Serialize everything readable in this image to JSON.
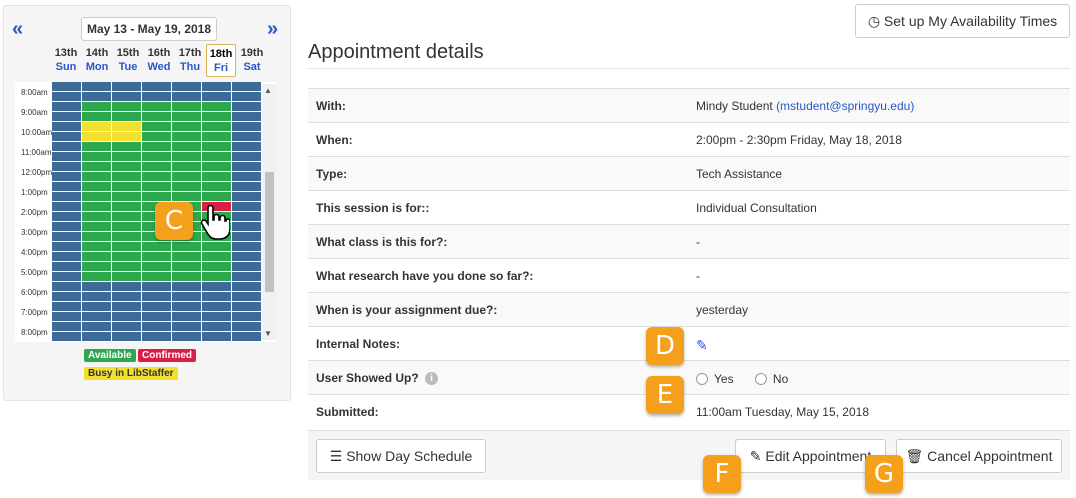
{
  "calendar": {
    "prev_icon": "«",
    "next_icon": "»",
    "week_range": "May 13 - May 19, 2018",
    "days": [
      {
        "num": "13th",
        "name": "Sun"
      },
      {
        "num": "14th",
        "name": "Mon"
      },
      {
        "num": "15th",
        "name": "Tue"
      },
      {
        "num": "16th",
        "name": "Wed"
      },
      {
        "num": "17th",
        "name": "Thu"
      },
      {
        "num": "18th",
        "name": "Fri"
      },
      {
        "num": "19th",
        "name": "Sat"
      }
    ],
    "selected_day_index": 5,
    "time_labels": [
      "8:00am",
      "9:00am",
      "10:00am",
      "11:00am",
      "12:00pm",
      "1:00pm",
      "2:00pm",
      "3:00pm",
      "4:00pm",
      "5:00pm",
      "6:00pm",
      "7:00pm",
      "8:00pm"
    ],
    "colors": {
      "unavailable": "#3d6a96",
      "available": "#2da84f",
      "confirmed": "#d91e4a",
      "busy": "#f2e030"
    },
    "legend": {
      "available": "Available",
      "confirmed": "Confirmed",
      "busy": "Busy in LibStaffer"
    }
  },
  "header": {
    "availability_button": "Set up My Availability Times",
    "availability_icon": "clock-icon",
    "title": "Appointment details"
  },
  "details": {
    "with_label": "With:",
    "with_name": "Mindy Student",
    "with_email": "(mstudent@springyu.edu)",
    "when_label": "When:",
    "when_value": "2:00pm - 2:30pm Friday, May 18, 2018",
    "type_label": "Type:",
    "type_value": "Tech Assistance",
    "session_label": "This session is for::",
    "session_value": "Individual Consultation",
    "class_label": "What class is this for?:",
    "class_value": "-",
    "research_label": "What research have you done so far?:",
    "research_value": "-",
    "due_label": "When is your assignment due?:",
    "due_value": "yesterday",
    "notes_label": "Internal Notes:",
    "showed_label": "User Showed Up?",
    "showed_yes": "Yes",
    "showed_no": "No",
    "submitted_label": "Submitted:",
    "submitted_value": "11:00am Tuesday, May 15, 2018"
  },
  "footer": {
    "show_day_schedule": "Show Day Schedule",
    "edit_appointment": "Edit Appointment",
    "cancel_appointment": "Cancel Appointment"
  },
  "callouts": {
    "c": "C",
    "d": "D",
    "e": "E",
    "f": "F",
    "g": "G"
  }
}
